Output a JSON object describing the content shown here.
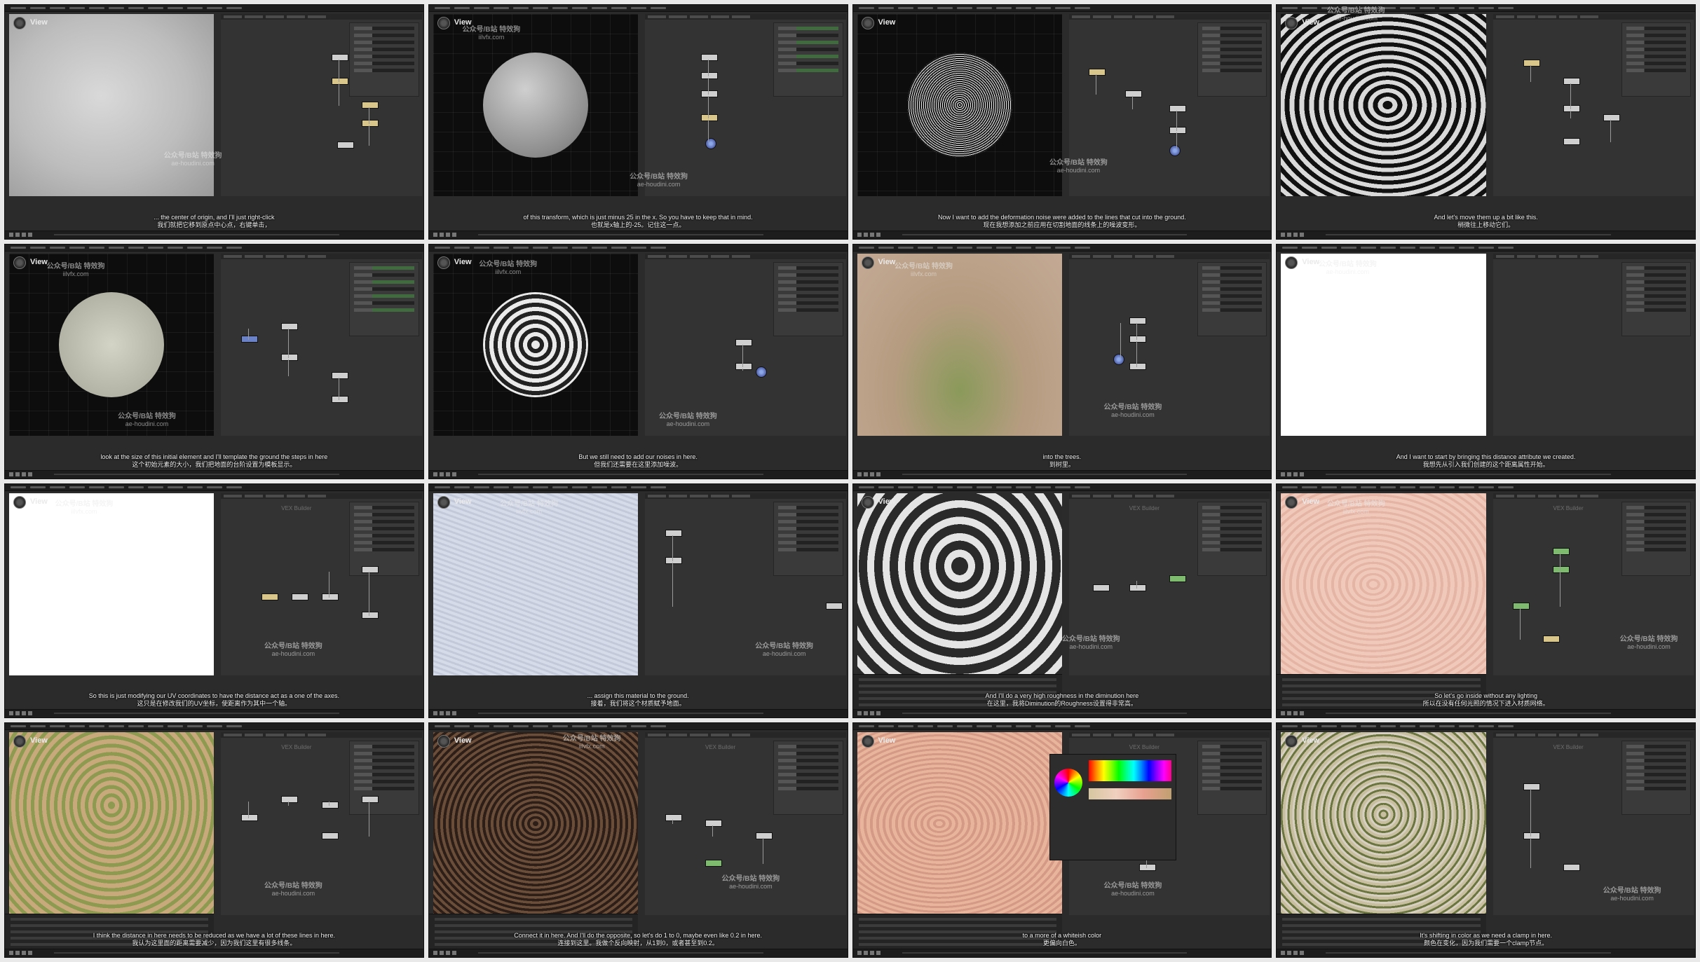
{
  "view_label": "View",
  "vex_builder_label": "VEX Builder",
  "watermark": {
    "line1": "公众号/B站 特效狗",
    "url_a": "iilvfx.com",
    "url_b": "ae-houdini.com"
  },
  "colors": {
    "background": "#e9e9e9",
    "panel": "#2b2b2b",
    "node_default": "#cfcfcf",
    "node_selected": "#d8c68a",
    "accent_green": "#7ebb6e"
  },
  "frames": [
    {
      "en": "... the center of origin, and I'll just right-click",
      "zh": "我们就把它移到原点中心点，右键单击，"
    },
    {
      "en": "of this transform, which is just minus 25 in the x. So you have to keep that in mind.",
      "zh": "也就是x轴上的-25。记住这一点。"
    },
    {
      "en": "Now I want to add the deformation noise were added to the lines that cut into the ground.",
      "zh": "现在我想添加之前应用在切割地面的线条上的噪波变形。"
    },
    {
      "en": "And let's move them up a bit like this.",
      "zh": "稍微往上移动它们。"
    },
    {
      "en": "look at the size of this initial element and I'll template the ground the steps in here",
      "zh": "这个初始元素的大小，我们把地面的台阶设置为模板显示。"
    },
    {
      "en": "But we still need to add our noises in here.",
      "zh": "但我们还需要在这里添加噪波。"
    },
    {
      "en": "into the trees.",
      "zh": "到树里。"
    },
    {
      "en": "And I want to start by bringing this distance attribute we created.",
      "zh": "我想先从引入我们创建的这个距离属性开始。"
    },
    {
      "en": "So this is just modifying our UV coordinates to have the distance act as a one of the axes.",
      "zh": "这只是在修改我们的UV坐标，使距离作为其中一个轴。"
    },
    {
      "en": "... assign this material to the ground.",
      "zh": "接着，我们将这个材质赋予地面。"
    },
    {
      "en": "And I'll do a very high roughness in the diminution here",
      "zh": "在这里，我将Diminution的Roughness设置得非常高。"
    },
    {
      "en": "So let's go inside without any lighting",
      "zh": "所以在没有任何光照的情况下进入材质网络。"
    },
    {
      "en": "I think the distance in here needs to be reduced as we have a lot of these lines in here.",
      "zh": "我认为这里面的距离需要减少，因为我们这里有很多线条。"
    },
    {
      "en": "Connect it in here. And I'll do the opposite, so let's do 1 to 0, maybe even like 0.2 in here.",
      "zh": "连接到这里。我做个反向映射，从1到0，或者甚至到0.2。"
    },
    {
      "en": "to a more of a whiteish color",
      "zh": "更偏向白色。"
    },
    {
      "en": "It's shifting in color as we need a clamp in here.",
      "zh": "颜色在变化，因为我们需要一个clamp节点。"
    }
  ]
}
